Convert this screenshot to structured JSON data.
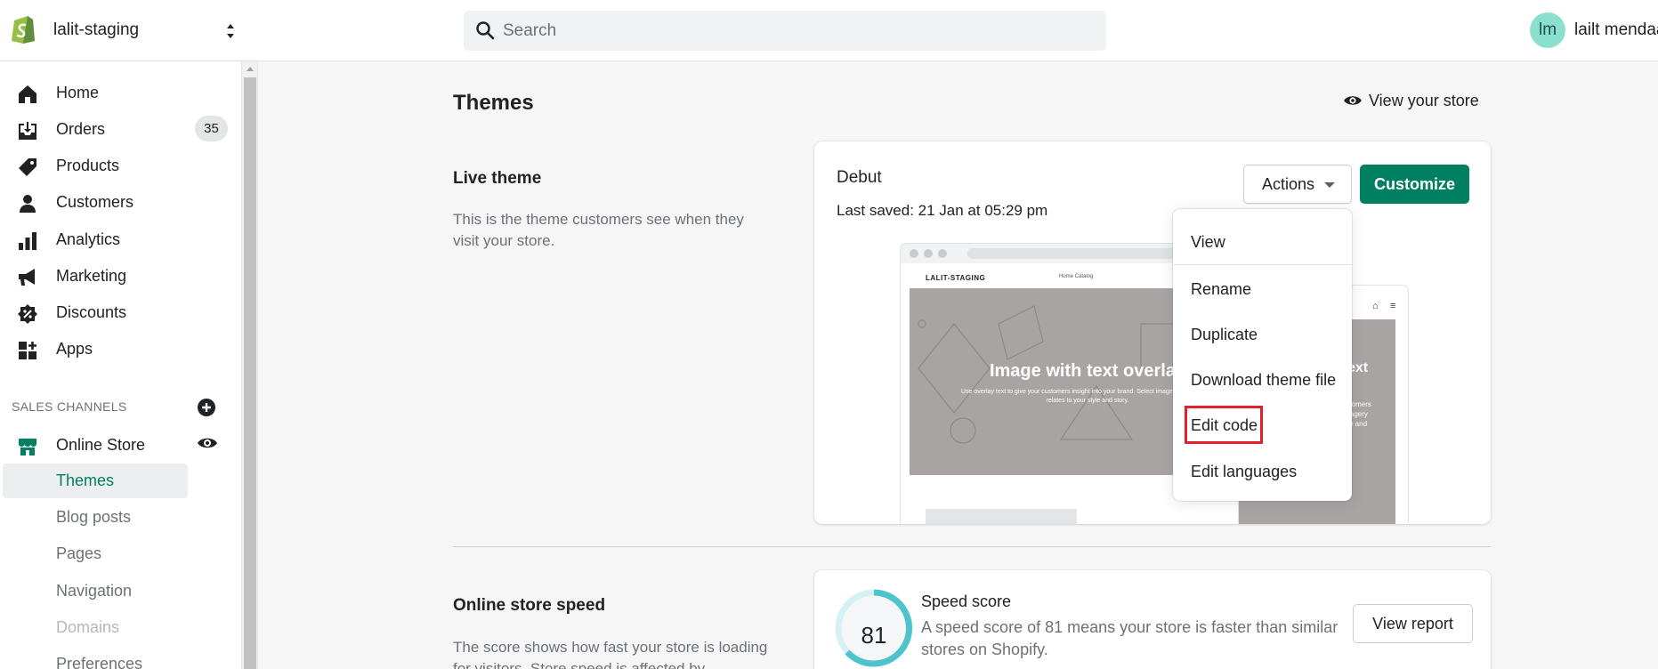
{
  "topbar": {
    "store_name": "lalit-staging",
    "search_placeholder": "Search",
    "avatar_initials": "lm",
    "user_name": "lailt mendaa",
    "icons": [
      "shopify-logo-icon",
      "chevron-updown-icon",
      "search-icon"
    ]
  },
  "sidebar": {
    "items": [
      {
        "label": "Home",
        "icon": "home-icon"
      },
      {
        "label": "Orders",
        "icon": "orders-icon",
        "badge": "35"
      },
      {
        "label": "Products",
        "icon": "tag-icon"
      },
      {
        "label": "Customers",
        "icon": "person-icon"
      },
      {
        "label": "Analytics",
        "icon": "bar-chart-icon"
      },
      {
        "label": "Marketing",
        "icon": "megaphone-icon"
      },
      {
        "label": "Discounts",
        "icon": "discount-icon"
      },
      {
        "label": "Apps",
        "icon": "apps-icon"
      }
    ],
    "sales_channels_heading": "SALES CHANNELS",
    "online_store": {
      "label": "Online Store",
      "icon": "store-icon"
    },
    "sub_items": [
      {
        "label": "Themes",
        "state": "active"
      },
      {
        "label": "Blog posts",
        "state": "normal"
      },
      {
        "label": "Pages",
        "state": "normal"
      },
      {
        "label": "Navigation",
        "state": "normal"
      },
      {
        "label": "Domains",
        "state": "disabled"
      },
      {
        "label": "Preferences",
        "state": "normal"
      }
    ]
  },
  "main": {
    "title": "Themes",
    "view_store_label": "View your store",
    "live_theme": {
      "heading": "Live theme",
      "description": "This is the theme customers see when they visit your store.",
      "theme_name": "Debut",
      "last_saved": "Last saved: 21 Jan at 05:29 pm",
      "actions_label": "Actions",
      "customize_label": "Customize",
      "preview": {
        "brand": "LALIT-STAGING",
        "links": "Home     Catalog",
        "hero_title": "Image with text overlay",
        "hero_sub": "Use overlay text to give your customers insight into your brand. Select imagery and text that relates to your style and story.",
        "mobile_title": "ext",
        "mobile_sub": "customers\nt imagery\nstyle and"
      }
    },
    "actions_menu": [
      "View",
      "Rename",
      "Duplicate",
      "Download theme file",
      "Edit code",
      "Edit languages"
    ],
    "speed": {
      "heading": "Online store speed",
      "description": "The score shows how fast your store is loading for visitors. Store speed is affected by",
      "score": "81",
      "score_title": "Speed score",
      "score_desc": "A speed score of 81 means your store is faster than similar stores on Shopify.",
      "view_report_label": "View report"
    }
  },
  "colors": {
    "accent_green": "#008060",
    "highlight_red": "#e0202b",
    "gauge_teal": "#4fc3cc"
  }
}
